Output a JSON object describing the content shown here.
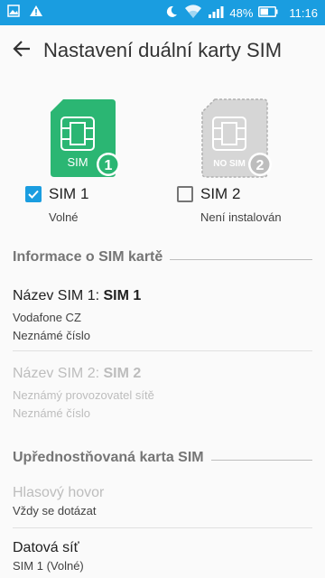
{
  "status_bar": {
    "battery_percent": "48%",
    "time": "11:16",
    "icons": [
      "image-icon",
      "warning-icon",
      "moon-icon",
      "wifi-icon",
      "signal-icon",
      "battery-icon"
    ]
  },
  "toolbar": {
    "title": "Nastavení duální karty SIM"
  },
  "sims": [
    {
      "label": "SIM 1",
      "status": "Volné",
      "checked": true,
      "badge_text": "SIM",
      "badge_number": "1",
      "color": "#2bb673"
    },
    {
      "label": "SIM 2",
      "status": "Není instalován",
      "checked": false,
      "badge_text": "NO SIM",
      "badge_number": "2",
      "color": "#bdbdbd"
    }
  ],
  "sim_info": {
    "header": "Informace o SIM kartě",
    "sim1": {
      "title_prefix": "Název SIM 1: ",
      "title_name": "SIM 1",
      "operator": "Vodafone CZ",
      "number": "Neznámé číslo"
    },
    "sim2": {
      "title_prefix": "Název SIM 2: ",
      "title_name": "SIM 2",
      "operator": "Neznámý provozovatel sítě",
      "number": "Neznámé číslo"
    }
  },
  "preferred": {
    "header": "Upřednostňovaná karta SIM",
    "voice": {
      "title": "Hlasový hovor",
      "value": "Vždy se dotázat"
    },
    "data": {
      "title": "Datová síť",
      "value": "SIM 1 (Volné)"
    }
  }
}
